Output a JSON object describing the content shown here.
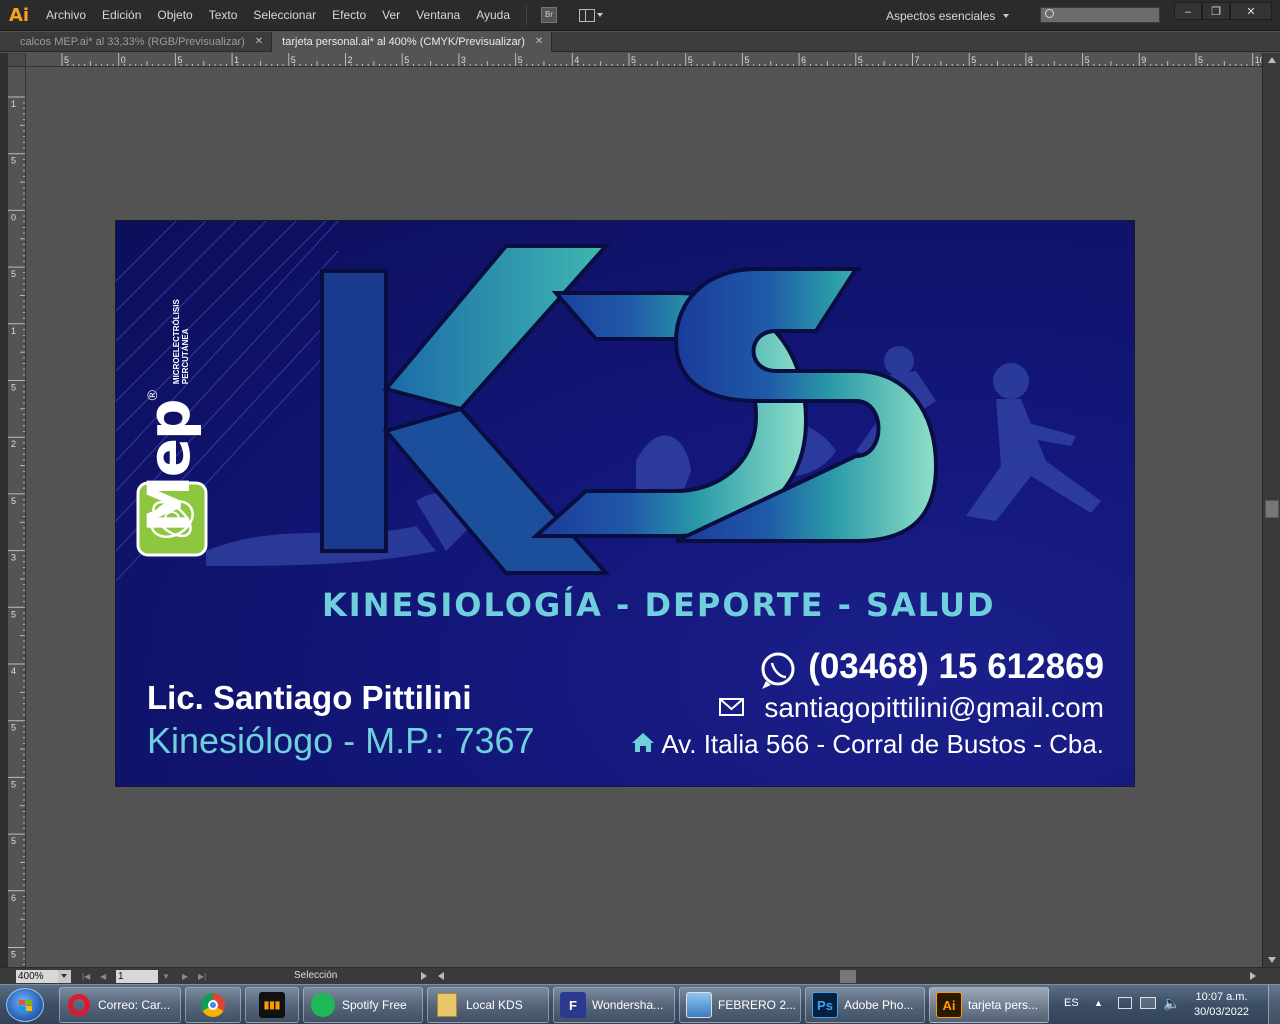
{
  "app": {
    "logo": "Ai",
    "menu": [
      "Archivo",
      "Edición",
      "Objeto",
      "Texto",
      "Seleccionar",
      "Efecto",
      "Ver",
      "Ventana",
      "Ayuda"
    ],
    "bridge_label": "Br",
    "workspace": "Aspectos esenciales",
    "window_controls": [
      "–",
      "❐",
      "✕"
    ]
  },
  "tabs": [
    {
      "label": "calcos MEP.ai* al 33,33% (RGB/Previsualizar)",
      "active": false
    },
    {
      "label": "tarjeta personal.ai* al 400% (CMYK/Previsualizar)",
      "active": true
    }
  ],
  "rulers": {
    "top_labels": [
      "5",
      "0",
      "5",
      "1",
      "5",
      "2",
      "5",
      "3",
      "5",
      "4",
      "5",
      "5",
      "5",
      "6",
      "5",
      "7",
      "5",
      "8",
      "5",
      "9",
      "5",
      "10"
    ],
    "left_labels": [
      "1",
      "5",
      "0",
      "5",
      "1",
      "5",
      "2",
      "5",
      "3",
      "5",
      "4",
      "5",
      "5",
      "5",
      "6",
      "5"
    ]
  },
  "card": {
    "brand_letters": "KDS",
    "tagline": "KINESIOLOGÍA - DEPORTE - SALUD",
    "name": "Lic. Santiago Pittilini",
    "title": "Kinesiólogo - M.P.: 7367",
    "phone": "(03468) 15 612869",
    "email": "santiagopittilini@gmail.com",
    "address": "Av. Italia 566 - Corral de Bustos - Cba.",
    "mep_logo": "Mep",
    "mep_registered": "®",
    "mep_sub1": "MICROELECTRÓLISIS",
    "mep_sub2": "PERCUTÁNEA",
    "colors": {
      "card_bg": "#13177a",
      "accent_teal": "#6fd0dc",
      "mep_green": "#8dc63f"
    },
    "icons": [
      "whatsapp-icon",
      "mail-icon",
      "home-icon"
    ]
  },
  "status": {
    "zoom": "400%",
    "page": "1",
    "tool": "Selección"
  },
  "taskbar": {
    "items": [
      {
        "label": "Correo: Car...",
        "icon": "opera-icon"
      },
      {
        "label": "",
        "icon": "chrome-icon"
      },
      {
        "label": "",
        "icon": "audio-app-icon"
      },
      {
        "label": "Spotify Free",
        "icon": "spotify-icon"
      },
      {
        "label": "Local KDS",
        "icon": "folder-icon"
      },
      {
        "label": "Wondersha...",
        "icon": "wondershare-icon"
      },
      {
        "label": "FEBRERO 2...",
        "icon": "image-viewer-icon"
      },
      {
        "label": "Adobe Pho...",
        "icon": "photoshop-icon"
      },
      {
        "label": "tarjeta pers...",
        "icon": "illustrator-icon"
      }
    ],
    "lang": "ES",
    "time": "10:07 a.m.",
    "date": "30/03/2022"
  }
}
